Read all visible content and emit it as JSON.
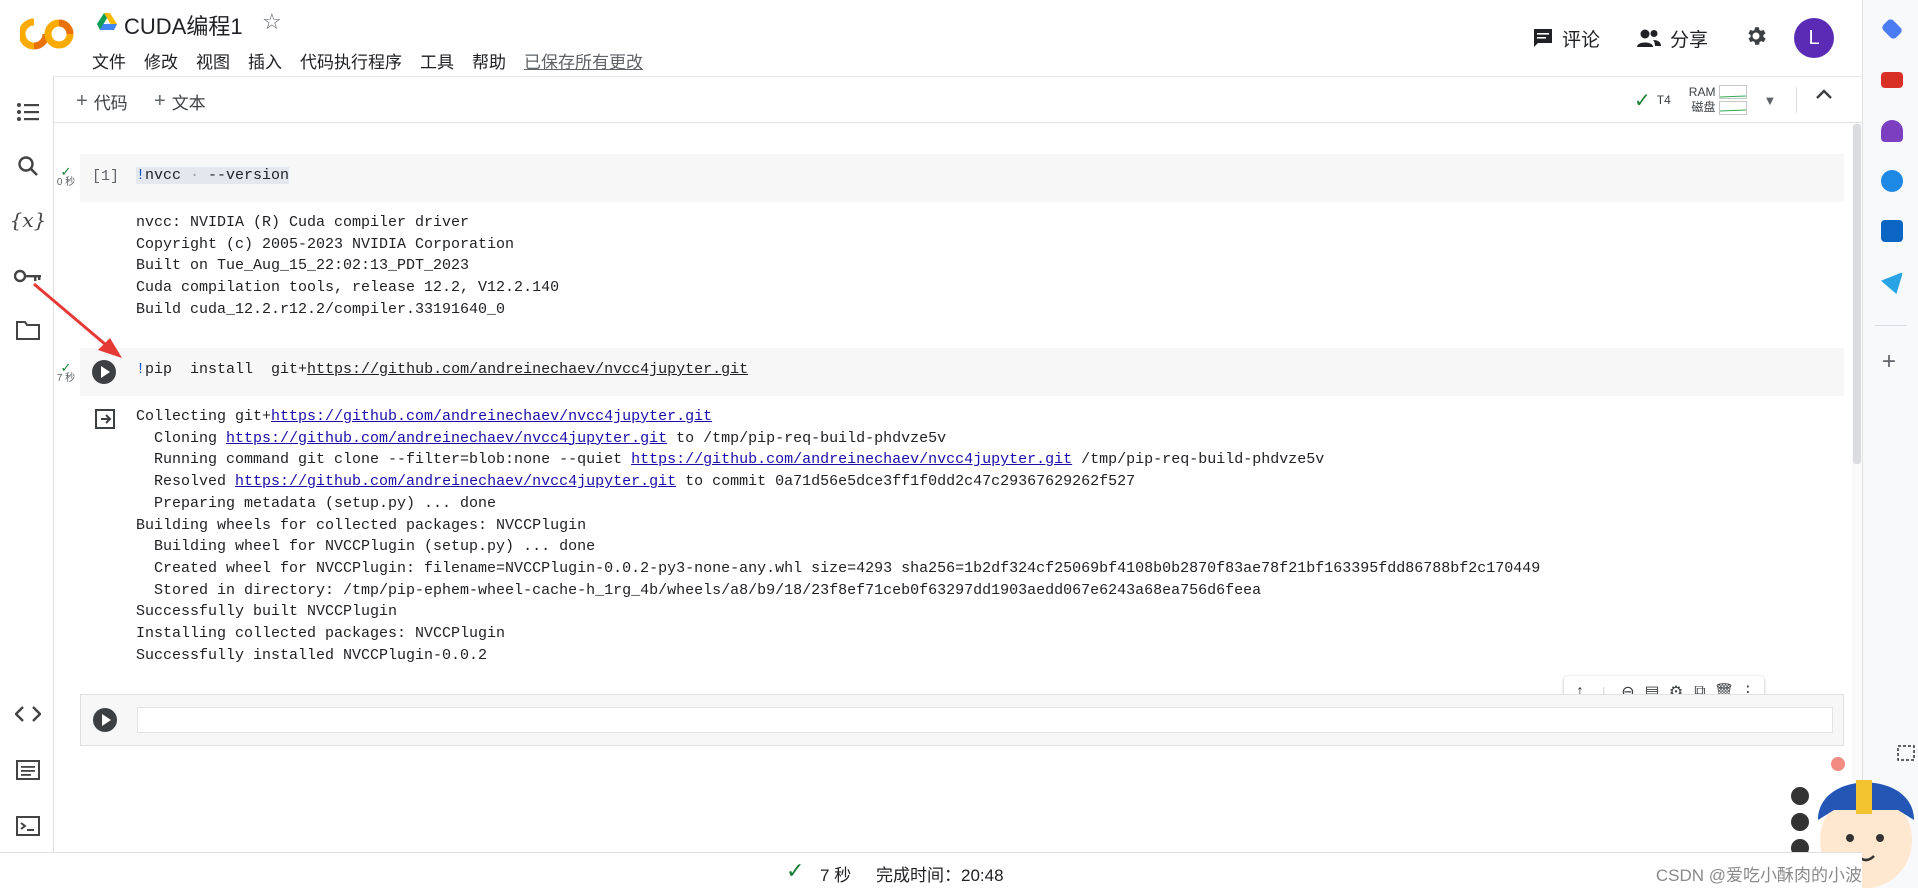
{
  "header": {
    "title": "CUDA编程1",
    "menu": [
      "文件",
      "修改",
      "视图",
      "插入",
      "代码执行程序",
      "工具",
      "帮助"
    ],
    "saved_status": "已保存所有更改",
    "comment_label": "评论",
    "share_label": "分享",
    "avatar_letter": "L"
  },
  "toolbar": {
    "add_code": "代码",
    "add_text": "文本",
    "runtime_gpu": "T4",
    "ram_label": "RAM",
    "disk_label": "磁盘"
  },
  "cells": [
    {
      "exec_count": "[1]",
      "status_time": "0 秒",
      "code_bang": "!",
      "code_cmd": "nvcc",
      "code_args": "--version",
      "output": [
        "nvcc: NVIDIA (R) Cuda compiler driver",
        "Copyright (c) 2005-2023 NVIDIA Corporation",
        "Built on Tue_Aug_15_22:02:13_PDT_2023",
        "Cuda compilation tools, release 12.2, V12.2.140",
        "Build cuda_12.2.r12.2/compiler.33191640_0"
      ]
    },
    {
      "status_time": "7 秒",
      "code_bang": "!",
      "code_cmd": "pip  install  git+",
      "code_url": "https://github.com/andreinechaev/nvcc4jupyter.git",
      "output": {
        "l1_pre": "Collecting git+",
        "url": "https://github.com/andreinechaev/nvcc4jupyter.git",
        "l2_pre": "  Cloning ",
        "l2_post": " to /tmp/pip-req-build-phdvze5v",
        "l3_pre": "  Running command git clone --filter=blob:none --quiet ",
        "l3_post": " /tmp/pip-req-build-phdvze5v",
        "l4_pre": "  Resolved ",
        "l4_post": " to commit 0a71d56e5dce3ff1f0dd2c47c29367629262f527",
        "l5": "  Preparing metadata (setup.py) ... done",
        "l6": "Building wheels for collected packages: NVCCPlugin",
        "l7": "  Building wheel for NVCCPlugin (setup.py) ... done",
        "l8": "  Created wheel for NVCCPlugin: filename=NVCCPlugin-0.0.2-py3-none-any.whl size=4293 sha256=1b2df324cf25069bf4108b0b2870f83ae78f21bf163395fdd86788bf2c170449",
        "l9": "  Stored in directory: /tmp/pip-ephem-wheel-cache-h_1rg_4b/wheels/a8/b9/18/23f8ef71ceb0f63297dd1903aedd067e6243a68ea756d6feea",
        "l10": "Successfully built NVCCPlugin",
        "l11": "Installing collected packages: NVCCPlugin",
        "l12": "Successfully installed NVCCPlugin-0.0.2"
      }
    }
  ],
  "statusbar": {
    "duration": "7 秒",
    "completed": "完成时间：20:48",
    "watermark": "CSDN @爱吃小酥肉的小波"
  },
  "colors": {
    "accent": "#1a73e8",
    "success": "#188038",
    "avatar": "#5b2bb5",
    "logo_orange": "#f9ab00",
    "logo_dark": "#e8710a"
  }
}
